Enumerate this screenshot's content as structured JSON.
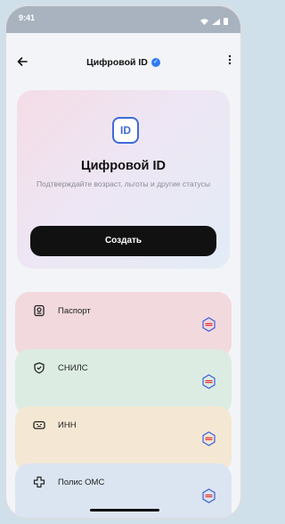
{
  "status_bar": {
    "time": "9:41"
  },
  "header": {
    "title": "Цифровой ID",
    "back_icon": "arrow-left-icon",
    "more_icon": "more-vertical-icon"
  },
  "hero": {
    "badge_text": "ID",
    "title": "Цифровой ID",
    "subtitle": "Подтверждайте возраст, льготы и другие статусы",
    "create_label": "Создать"
  },
  "documents": [
    {
      "label": "Паспорт",
      "icon": "passport-icon"
    },
    {
      "label": "СНИЛС",
      "icon": "shield-check-icon"
    },
    {
      "label": "ИНН",
      "icon": "id-card-icon"
    },
    {
      "label": "Полис ОМС",
      "icon": "medical-cross-icon"
    }
  ],
  "colors": {
    "accent": "#2f7bf6",
    "badge": "#3f6bd8",
    "button": "#111111"
  }
}
